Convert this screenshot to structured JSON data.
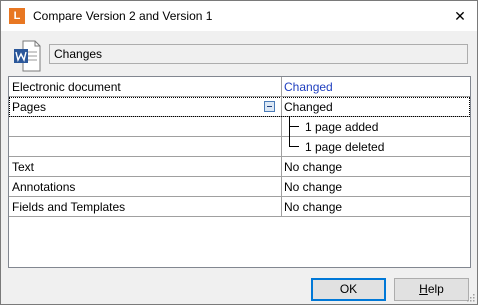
{
  "window": {
    "title": "Compare Version 2 and Version 1",
    "app_logo_letter": "L",
    "close_glyph": "✕"
  },
  "summary": {
    "label": "Changes"
  },
  "comparison": {
    "rows": [
      {
        "label": "Electronic document",
        "value": "Changed"
      },
      {
        "label": "Pages",
        "value": "Changed"
      },
      {
        "label": "",
        "value": "1 page added"
      },
      {
        "label": "",
        "value": "1 page deleted"
      },
      {
        "label": "Text",
        "value": "No change"
      },
      {
        "label": "Annotations",
        "value": "No change"
      },
      {
        "label": "Fields and Templates",
        "value": "No change"
      }
    ]
  },
  "buttons": {
    "ok": "OK",
    "help_mnemonic": "H",
    "help_rest": "elp"
  },
  "colors": {
    "link": "#1f3fbf",
    "app_accent": "#e87722",
    "word_blue": "#2b579a"
  },
  "icons": {
    "app": "app-logo-icon",
    "document": "word-document-icon",
    "close": "close-icon"
  }
}
